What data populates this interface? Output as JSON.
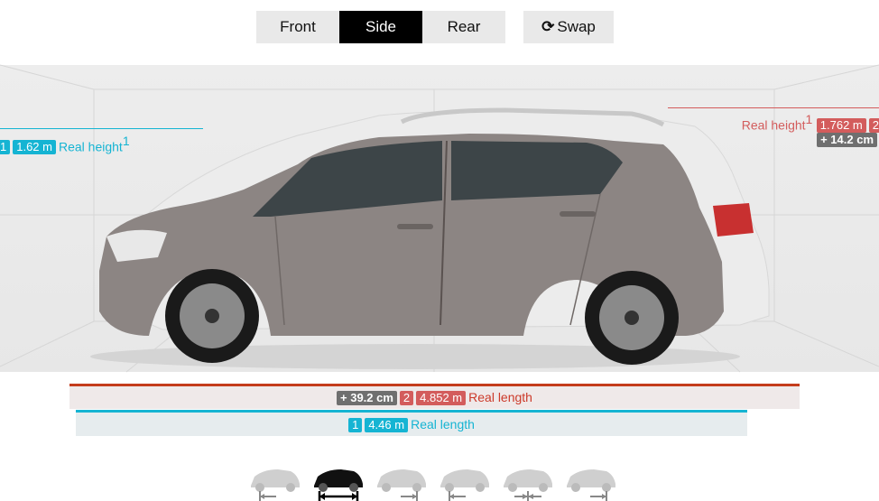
{
  "view_toggle": {
    "front": "Front",
    "side": "Side",
    "rear": "Rear",
    "active": "Side"
  },
  "swap": {
    "label": "Swap",
    "icon": "refresh-icon"
  },
  "height_left": {
    "badge_index": "1",
    "value": "1.62 m",
    "label": "Real height",
    "footnote": "1"
  },
  "height_right": {
    "label": "Real height",
    "footnote": "1",
    "value": "1.762 m",
    "badge_index": "2",
    "difference": "+ 14.2 cm"
  },
  "length_top": {
    "difference": "+ 39.2 cm",
    "badge_index": "2",
    "value": "4.852 m",
    "label": "Real length"
  },
  "length_bottom": {
    "badge_index": "1",
    "value": "4.46 m",
    "label": "Real length"
  },
  "car_alignments": [
    "align-left-icon",
    "align-center-icon",
    "align-right-icon",
    "align-left-icon",
    "align-center-icon",
    "align-right-icon"
  ],
  "colors": {
    "car1": "#8c8583",
    "car2": "#ececec",
    "accent_cyan": "#15b4d3",
    "accent_red": "#d35c5c",
    "accent_orange": "#c43c1c"
  }
}
